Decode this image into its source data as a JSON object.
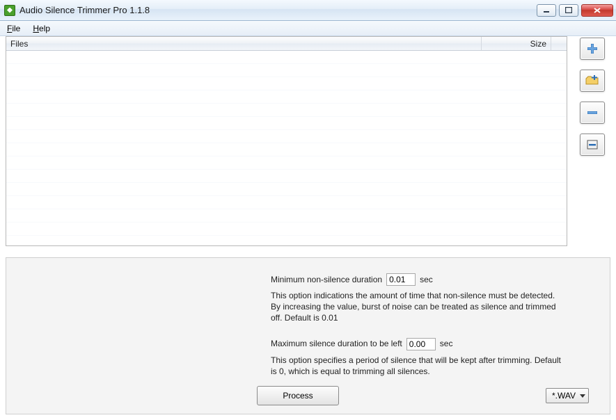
{
  "window": {
    "title": "Audio Silence Trimmer Pro 1.1.8"
  },
  "menu": {
    "file": "File",
    "help": "Help"
  },
  "grid": {
    "columns": {
      "files": "Files",
      "size": "Size"
    },
    "rows": []
  },
  "side_buttons": {
    "add_file": "add-file",
    "add_folder": "add-folder",
    "remove": "remove",
    "remove_all": "remove-all"
  },
  "options": {
    "min_nonsilence": {
      "label_pre": "Minimum non-silence duration",
      "value": "0.01",
      "label_post": "sec",
      "desc": "This option indications the amount of time that non-silence must be detected. By increasing the value, burst of noise can be treated as silence and trimmed off. Default is 0.01"
    },
    "max_silence": {
      "label_pre": "Maximum silence duration to be left",
      "value": "0.00",
      "label_post": "sec",
      "desc": "This option specifies a period of silence that will be kept after trimming. Default is 0, which is equal to trimming all silences."
    }
  },
  "actions": {
    "process": "Process",
    "output_format": "*.WAV"
  }
}
